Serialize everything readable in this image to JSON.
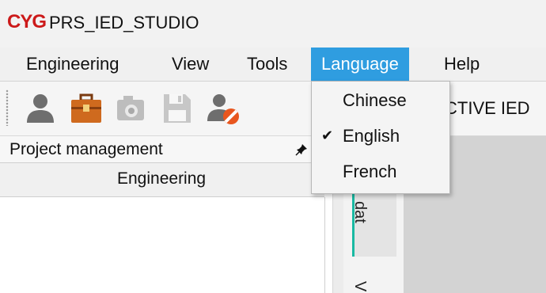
{
  "app": {
    "logo": "CYG",
    "title": "PRS_IED_STUDIO"
  },
  "menubar": {
    "items": [
      "Engineering",
      "View",
      "Tools",
      "Language",
      "Help"
    ],
    "active": "Language"
  },
  "toolbar": {
    "icons": [
      "user-icon",
      "briefcase-icon",
      "camera-icon",
      "save-icon",
      "user-forbidden-icon"
    ],
    "active_ied_text": "CTIVE IED"
  },
  "language_menu": {
    "items": [
      "Chinese",
      "English",
      "French"
    ],
    "checked": "English",
    "check_mark": "✔"
  },
  "project_panel": {
    "title": "Project management",
    "engineering_header": "Engineering"
  },
  "side_tabs": {
    "tab1": "dat",
    "tab2": "V"
  },
  "colors": {
    "accent": "#2f9de0",
    "logo": "#cc1a1a",
    "tab_accent": "#18b9a2"
  }
}
